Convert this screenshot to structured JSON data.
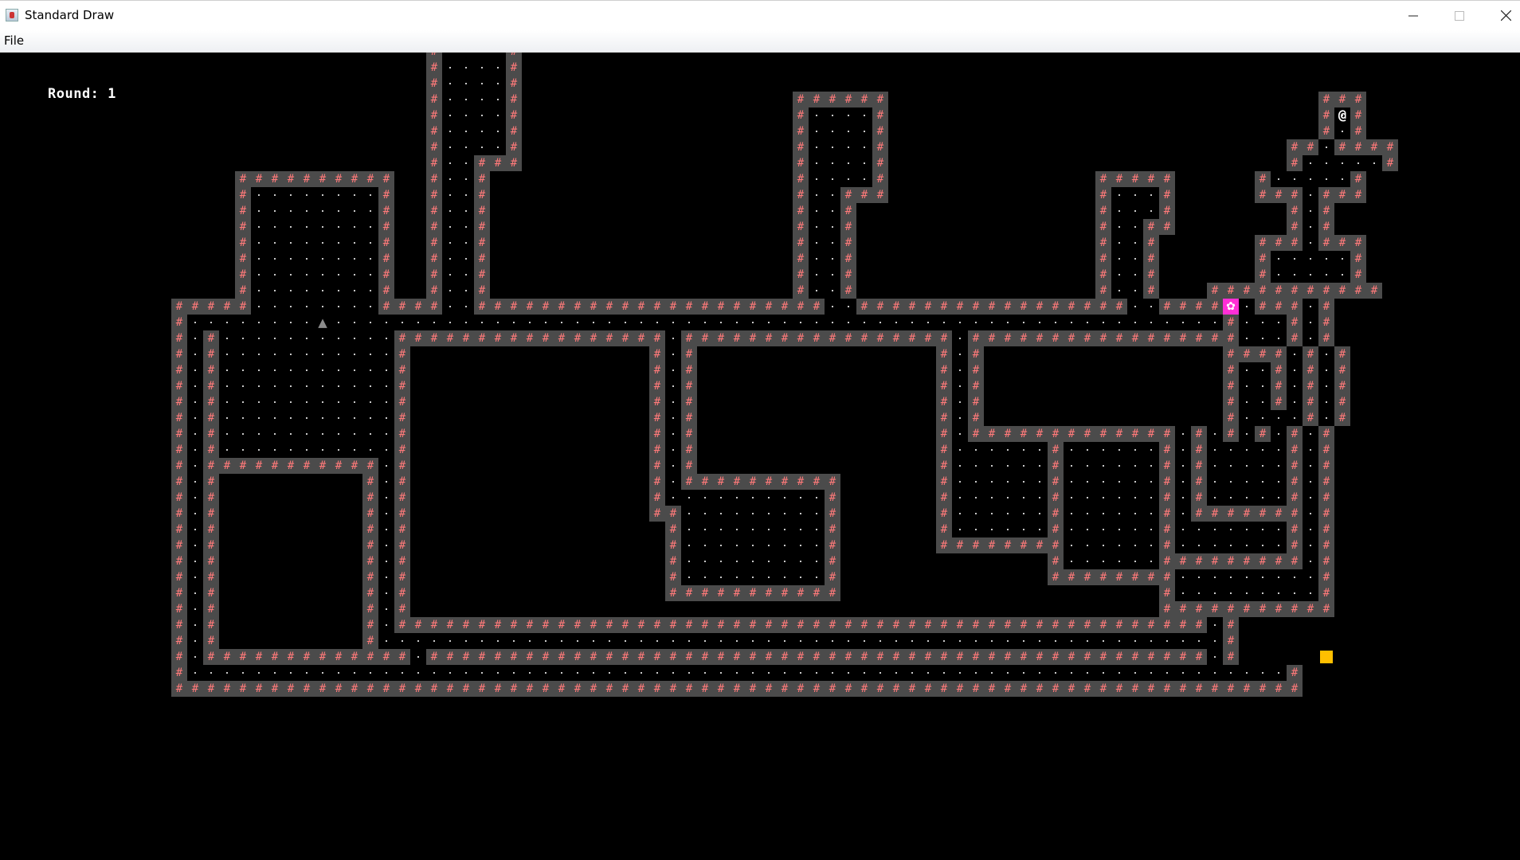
{
  "window": {
    "title": "Standard Draw",
    "icon": "java-cup-icon",
    "controls": {
      "minimize": "minimize-icon",
      "maximize": "maximize-icon",
      "close": "close-icon"
    }
  },
  "menu": {
    "file_label": "File"
  },
  "hud": {
    "round_text": "Round: 1"
  },
  "legend": {
    "wall_glyph": "#",
    "player_glyph": "@"
  },
  "colors": {
    "background": "#000000",
    "wall_fill": "#4b4b4b",
    "wall_glyph": "#ff7a7a",
    "floor_dot": "#c9c9c9",
    "item_star_bg": "#ff2fd6",
    "gold_square": "#ffbf00",
    "monster_triangle": "#8c8c8c",
    "player": "#ffffff"
  },
  "map": {
    "rows": [
      "                     #....#                                                      ",
      "                     #....#                                                      ",
      "                     #....#                                                      ",
      "                     #....#                 ######                           ### ",
      "                     #....#                 #....#                           #.# ",
      "                     #....#                 #....#                           #.# ",
      "                     #....#                 #....#                         ##.#### ",
      "                     #..###                 #....#                         #.....# ",
      "         ##########  #..#                   #....#             #####     #.....# ",
      "         #........#  #..#                   #..###             #...#     ###.### ",
      "         #........#  #..#                   #..#               #...#       #.#   ",
      "         #........#  #..#                   #..#               #..##       #.#   ",
      "         #........#  #..#                   #..#               #..#      ###.### ",
      "         #........#  #..#                   #..#               #..#      #.....# ",
      "         #........#  #..#                   #..#               #..#      #.....# ",
      "         #........#  #..#                   #..#               #..#   ###########",
      "     #####........####..######################..#################..#####.###.#  ",
      "     #.................................................................#...#.#  ",
      "     #.#...........#################.#################.#################...#.#  ",
      "     #.#...........#               #.#               #.#               ####.#.#  ",
      "     #.#...........#               #.#               #.#               #..#.#.#  ",
      "     #.#...........#               #.#               #.#               #..#.#.#  ",
      "     #.#...........#               #.#               #.#               #..#.#.#  ",
      "     #.#...........#               #.#               #.#               #....#.#  ",
      "     #.#...........#               #.#               #.#############.#.#.#.#.#  ",
      "     #.#...........#               #.#               #......#......#.#.....#.#  ",
      "     #.###########.#               #.#               #......#......#.#.....#.#  ",
      "     #.#         #.#               #.##########      #......#......#.#.....#.#  ",
      "     #.#         #.#               #..........#      #......#......#.#.....#.#  ",
      "     #.#         #.#               ##.........#      #......#......#.#######.#  ",
      "     #.#         #.#                #.........#      #......#......#.......#.#  ",
      "     #.#         #.#                #.........#      ########......#.......#.#  ",
      "     #.#         #.#                #.........#             #......#########.#  ",
      "     #.#         #.#                #.........#             ########.........#  ",
      "     #.#         #.#                ###########                    #.........#  ",
      "     #.#         #.#                                               ###########  ",
      "     #.#         #.###################################################.#      ",
      "     #.#         #.....................................................#      ",
      "     #.#############.#################################################.#      ",
      "     #.....................................................................#",
      "     #######################################################################"
    ],
    "entities": [
      {
        "name": "player",
        "glyph": "@",
        "col": 78,
        "row": 4
      },
      {
        "name": "item-star",
        "glyph": "✿",
        "col": 71,
        "row": 16
      },
      {
        "name": "monster-triangle",
        "glyph": "▲",
        "col": 14,
        "row": 17
      },
      {
        "name": "gold-square",
        "glyph": "■",
        "col": 77,
        "row": 38
      }
    ]
  }
}
